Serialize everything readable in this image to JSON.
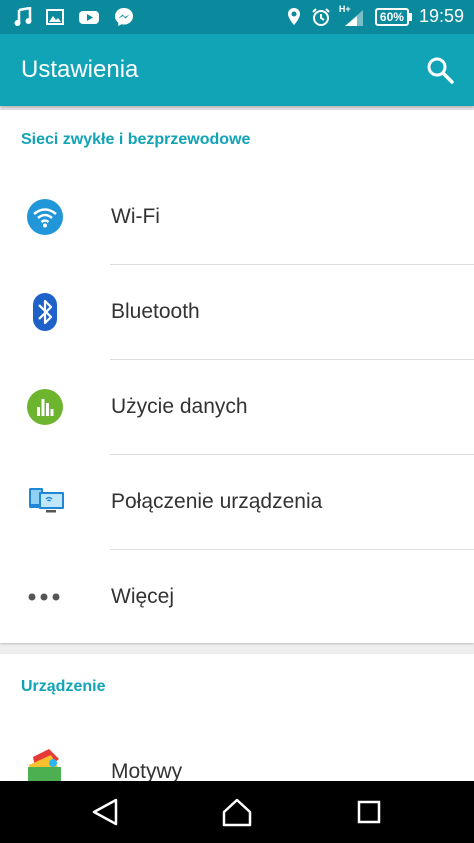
{
  "status_bar": {
    "left_icons": [
      "music-icon",
      "image-icon",
      "youtube-icon",
      "messenger-icon"
    ],
    "right_icons": [
      "location-icon",
      "alarm-icon",
      "signal-icon"
    ],
    "network_type": "H+",
    "battery": "60%",
    "time": "19:59"
  },
  "app_bar": {
    "title": "Ustawienia",
    "search_icon": "search-icon"
  },
  "sections": [
    {
      "title": "Sieci zwykłe i bezprzewodowe",
      "items": [
        {
          "label": "Wi-Fi",
          "icon": "wifi-icon"
        },
        {
          "label": "Bluetooth",
          "icon": "bluetooth-icon"
        },
        {
          "label": "Użycie danych",
          "icon": "data-usage-icon"
        },
        {
          "label": "Połączenie urządzenia",
          "icon": "device-connection-icon"
        },
        {
          "label": "Więcej",
          "icon": "more-icon"
        }
      ]
    },
    {
      "title": "Urządzenie",
      "items": [
        {
          "label": "Motywy",
          "icon": "themes-icon"
        }
      ]
    }
  ],
  "nav_bar": {
    "buttons": [
      "back-icon",
      "home-icon",
      "recents-icon"
    ]
  },
  "colors": {
    "status_bar": "#0a8a9c",
    "app_bar": "#11a3b6",
    "accent": "#11a3b6",
    "background": "#eeeeee"
  }
}
